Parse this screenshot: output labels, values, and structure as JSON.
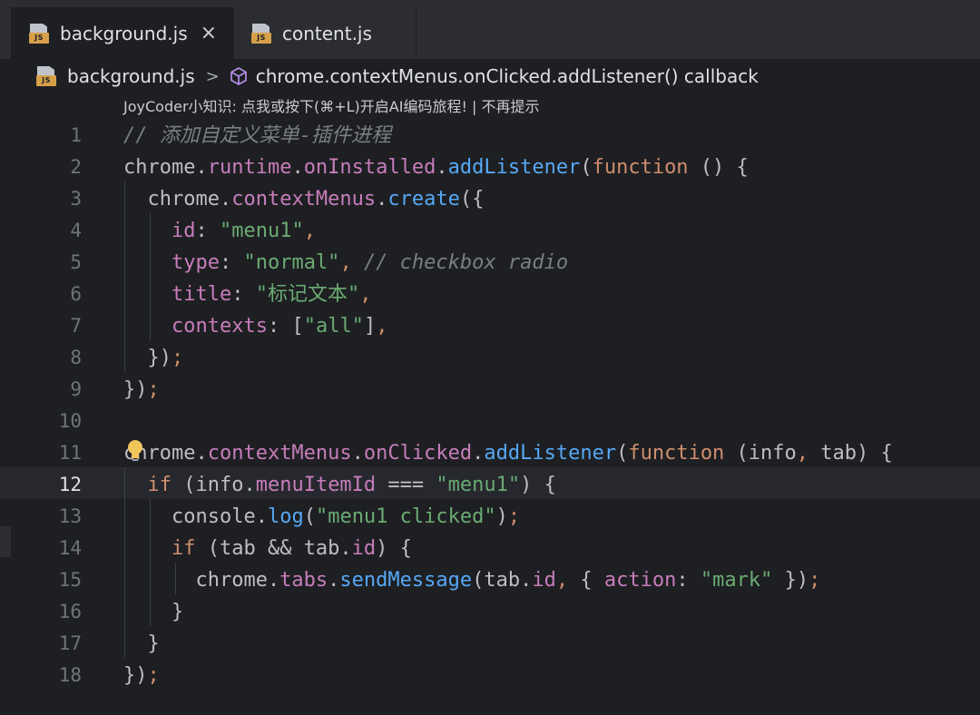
{
  "tabs": [
    {
      "label": "background.js",
      "icon": "js-file-icon",
      "close": "×"
    },
    {
      "label": "content.js",
      "icon": "js-file-icon"
    }
  ],
  "breadcrumb": {
    "file": "background.js",
    "separator": ">",
    "symbol": "chrome.contextMenus.onClicked.addListener() callback"
  },
  "tip": "JoyCoder小知识: 点我或按下(⌘+L)开启AI编码旅程! | 不再提示",
  "js_badge": "JS",
  "current_line": 12,
  "colors": {
    "keyword": "#cf8e6d",
    "string": "#6aab73",
    "comment": "#7a7e85",
    "property": "#c77dbb",
    "function": "#56a8f5",
    "text": "#bcbec4",
    "accent_bulb": "#f2c55c"
  },
  "code_lines": [
    {
      "n": "1",
      "html": "<i style=\"color:#7a7e85\">// 添加自定义菜单-插件进程</i>"
    },
    {
      "n": "2",
      "html": "chrome.<span style=\"color:#c77dbb\">runtime</span>.<span style=\"color:#c77dbb\">onInstalled</span>.<span style=\"color:#56a8f5\">addListener</span>(<span style=\"color:#cf8e6d\">function</span> () {"
    },
    {
      "n": "3",
      "html": "  chrome.<span style=\"color:#c77dbb\">contextMenus</span>.<span style=\"color:#56a8f5\">create</span>({"
    },
    {
      "n": "4",
      "html": "    <span style=\"color:#c77dbb\">id</span>: <span style=\"color:#6aab73\">\"menu1\"</span><span style=\"color:#cf8e6d\">,</span>"
    },
    {
      "n": "5",
      "html": "    <span style=\"color:#c77dbb\">type</span>: <span style=\"color:#6aab73\">\"normal\"</span><span style=\"color:#cf8e6d\">,</span> <i style=\"color:#7a7e85\">// checkbox radio</i>"
    },
    {
      "n": "6",
      "html": "    <span style=\"color:#c77dbb\">title</span>: <span style=\"color:#6aab73\">\"标记文本\"</span><span style=\"color:#cf8e6d\">,</span>"
    },
    {
      "n": "7",
      "html": "    <span style=\"color:#c77dbb\">contexts</span>: [<span style=\"color:#6aab73\">\"all\"</span>]<span style=\"color:#cf8e6d\">,</span>"
    },
    {
      "n": "8",
      "html": "  })<span style=\"color:#cf8e6d\">;</span>"
    },
    {
      "n": "9",
      "html": "})<span style=\"color:#cf8e6d\">;</span>"
    },
    {
      "n": "10",
      "html": ""
    },
    {
      "n": "11",
      "html": "chrome.<span style=\"color:#c77dbb\">contextMenus</span>.<span style=\"color:#c77dbb\">onClicked</span>.<span style=\"color:#56a8f5\">addListener</span>(<span style=\"color:#cf8e6d\">function</span> (info<span style=\"color:#cf8e6d\">,</span> tab) {"
    },
    {
      "n": "12",
      "html": "  <span style=\"color:#cf8e6d\">if</span> (info.<span style=\"color:#c77dbb\">menuItemId</span> === <span style=\"color:#6aab73\">\"menu1\"</span>) {"
    },
    {
      "n": "13",
      "html": "    console.<span style=\"color:#56a8f5\">log</span>(<span style=\"color:#6aab73\">\"menu1 clicked\"</span>)<span style=\"color:#cf8e6d\">;</span>"
    },
    {
      "n": "14",
      "html": "    <span style=\"color:#cf8e6d\">if</span> (tab &amp;&amp; tab.<span style=\"color:#c77dbb\">id</span>) {"
    },
    {
      "n": "15",
      "html": "      chrome.<span style=\"color:#c77dbb\">tabs</span>.<span style=\"color:#56a8f5\">sendMessage</span>(tab.<span style=\"color:#c77dbb\">id</span><span style=\"color:#cf8e6d\">,</span> { <span style=\"color:#c77dbb\">action</span>: <span style=\"color:#6aab73\">\"mark\"</span> })<span style=\"color:#cf8e6d\">;</span>"
    },
    {
      "n": "16",
      "html": "    }"
    },
    {
      "n": "17",
      "html": "  }"
    },
    {
      "n": "18",
      "html": "})<span style=\"color:#cf8e6d\">;</span>"
    }
  ]
}
